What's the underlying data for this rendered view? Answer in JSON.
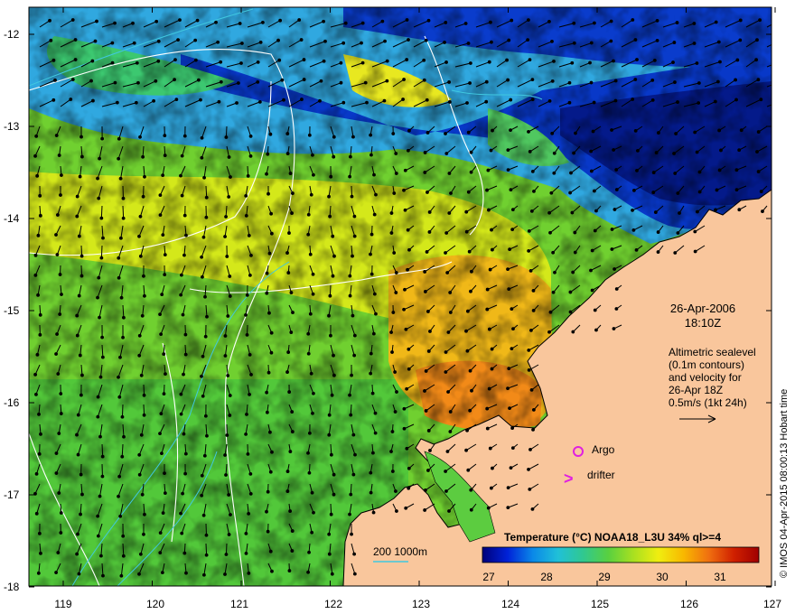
{
  "map": {
    "colors": {
      "land": "#f9c69c",
      "coast": "#000000",
      "contour": "#ffffff",
      "isobath": "#40c8e0",
      "marker": "#e020e0"
    },
    "lat_labels": [
      "-12",
      "-13",
      "-14",
      "-15",
      "-16",
      "-17",
      "-18"
    ],
    "lon_labels": [
      "119",
      "120",
      "121",
      "122",
      "123",
      "124",
      "125",
      "126",
      "127"
    ]
  },
  "annotations": {
    "date": "26-Apr-2006",
    "time": "18:10Z",
    "alti_lines": [
      "Altimetric sealevel",
      "(0.1m contours)",
      "and velocity for",
      "26-Apr 18Z",
      "0.5m/s (1kt 24h)"
    ],
    "credit": "© IMOS 04-Apr-2015 08:00:13 Hobart time",
    "argo_label": "Argo",
    "drifter_label": "drifter",
    "drifter_symbol": ">",
    "isobath_legend": "200  1000m"
  },
  "colorbar": {
    "title": "Temperature (°C) NOAA18_L3U 34% ql>=4",
    "ticks": [
      "27",
      "28",
      "29",
      "30",
      "31"
    ],
    "stops": [
      "#00007a",
      "#0022d8",
      "#0a88e8",
      "#20c0d8",
      "#30c890",
      "#58d040",
      "#a8e020",
      "#f0ee10",
      "#f8b800",
      "#f07010",
      "#d02000",
      "#a00000"
    ]
  }
}
